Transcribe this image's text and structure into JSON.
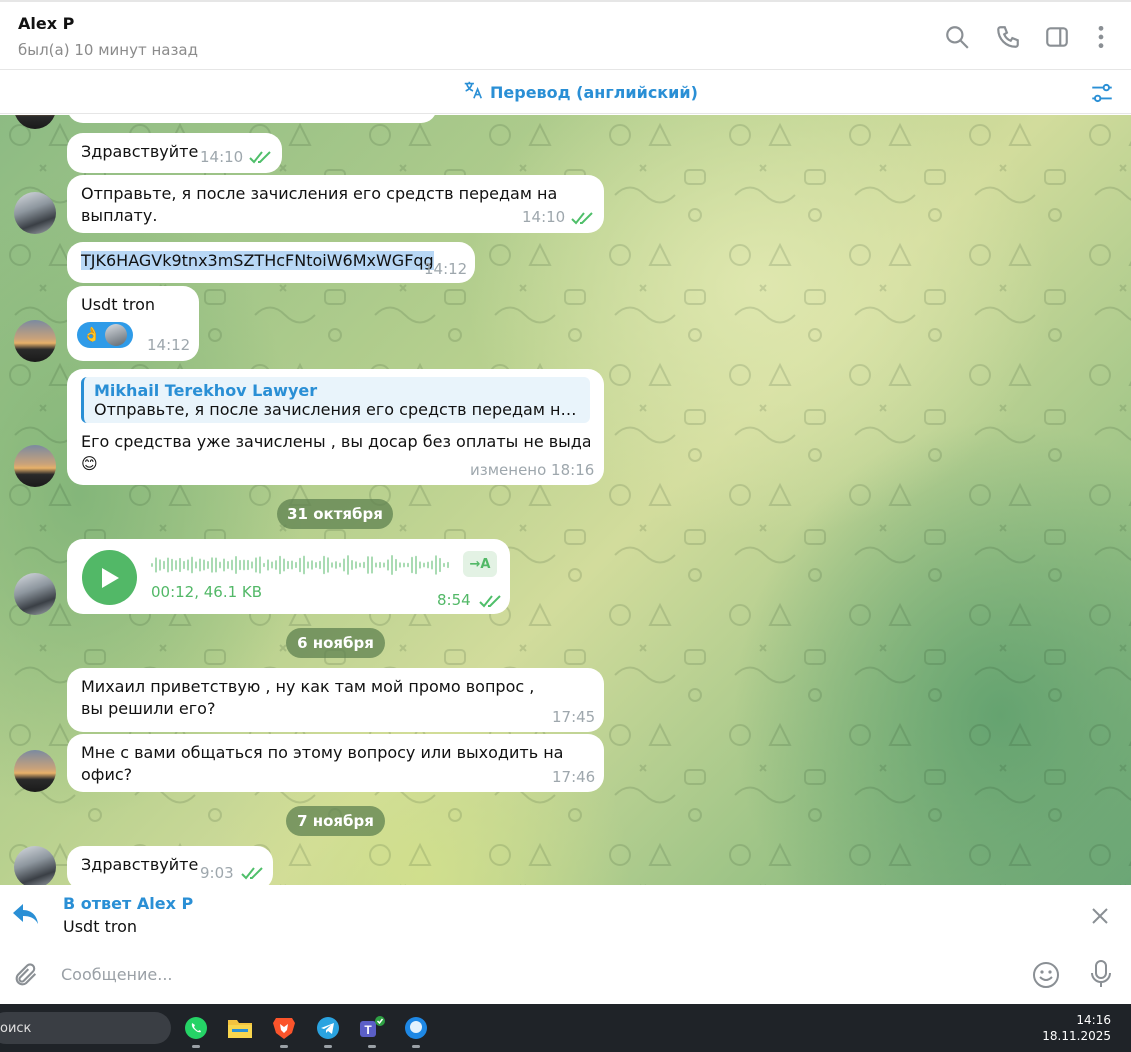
{
  "header": {
    "contact_name": "Alex P",
    "status": "был(а) 10 минут назад",
    "icons": [
      "search-icon",
      "phone-icon",
      "sidebar-toggle-icon",
      "more-vertical-icon"
    ]
  },
  "translate_bar": {
    "label": "Перевод (английский)",
    "icon": "translate-icon",
    "settings_icon": "sliders-icon"
  },
  "messages": [
    {
      "text": "Здравствуйте",
      "time": "14:10",
      "read": true
    },
    {
      "text": "Отправьте, я после зачисления его средств передам на выплату.",
      "time": "14:10",
      "read": true
    },
    {
      "text": "TJK6HAGVk9tnx3mSZTHcFNtoiW6MxWGFqg",
      "time": "14:12"
    },
    {
      "text": "Usdt tron",
      "time": "14:12",
      "reaction": "👌"
    },
    {
      "reply_author": "Mikhail Terekhov Lawyer",
      "reply_text": "Отправьте, я после зачисления его средств передам на вып...",
      "text": "Его средства уже зачислены , вы досар без оплаты не выдаете ...",
      "emoji": "😊",
      "time": "изменено 18:16"
    },
    {
      "voice_meta": "00:12, 46.1 KB",
      "transcribe_label": "→A",
      "time": "8:54",
      "read": true
    },
    {
      "text": "Михаил приветствую , ну как там мой промо вопрос  , вы решили его?",
      "time": "17:45"
    },
    {
      "text": "Мне с вами общаться по этому вопросу или выходить на офис?",
      "time": "17:46"
    },
    {
      "text": "Здравствуйте",
      "time": "9:03",
      "read": true
    }
  ],
  "dates": [
    "31 октября",
    "6 ноября",
    "7 ноября"
  ],
  "reply_panel": {
    "title": "В ответ Alex P",
    "text": "Usdt tron"
  },
  "composer": {
    "placeholder": "Сообщение..."
  },
  "taskbar": {
    "search_label": "оиск",
    "apps": [
      "whatsapp-icon",
      "file-explorer-icon",
      "brave-icon",
      "telegram-icon",
      "teams-icon",
      "messenger-icon"
    ],
    "time": "14:16",
    "date": "18.11.2025"
  },
  "colors": {
    "accent": "#2a8fd5",
    "read_check": "#4fbf6a",
    "voice": "#52b867"
  }
}
